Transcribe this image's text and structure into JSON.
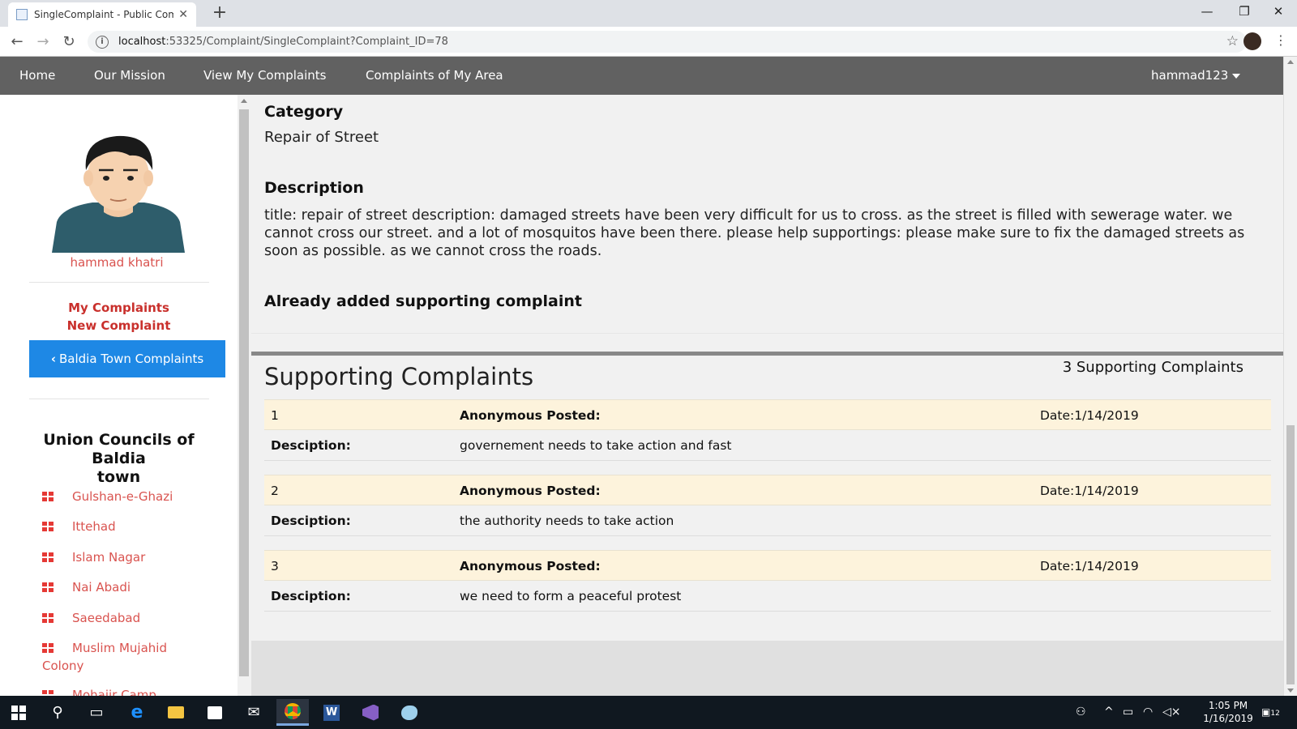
{
  "browser": {
    "tab_title": "SingleComplaint - Public Compla",
    "url_host": "localhost",
    "url_rest": ":53325/Complaint/SingleComplaint?Complaint_ID=78"
  },
  "nav": {
    "items": [
      "Home",
      "Our Mission",
      "View My Complaints",
      "Complaints of My Area"
    ],
    "user": "hammad123"
  },
  "sidebar": {
    "user_name": "hammad khatri",
    "my_complaints": "My Complaints",
    "new_complaint": "New Complaint",
    "area_button": "Baldia Town Complaints",
    "uc_heading_line1": "Union Councils of Baldia",
    "uc_heading_line2": "town",
    "councils": [
      "Gulshan-e-Ghazi",
      "Ittehad",
      "Islam Nagar",
      "Nai Abadi",
      "Saeedabad",
      "Muslim Mujahid Colony"
    ],
    "partial_item": "Mohajir Camp"
  },
  "complaint": {
    "category_label": "Category",
    "category_value": "Repair of Street",
    "description_label": "Description",
    "description_text": "title: repair of street description: damaged streets have been very difficult for us to cross. as the street is filled with sewerage water. we cannot cross our street. and a lot of mosquitos have been there. please help supportings: please make sure to fix the damaged streets as soon as possible. as we cannot cross the roads.",
    "status_text": "Already added supporting complaint"
  },
  "supporting": {
    "title": "Supporting Complaints",
    "count_text": "3 Supporting Complaints",
    "posted_label": "Anonymous Posted:",
    "desc_label": "Desciption:",
    "rows": [
      {
        "num": "1",
        "date": "Date:1/14/2019",
        "desc": "governement needs to take action and fast"
      },
      {
        "num": "2",
        "date": "Date:1/14/2019",
        "desc": "the authority needs to take action"
      },
      {
        "num": "3",
        "date": "Date:1/14/2019",
        "desc": "we need to form a peaceful protest"
      }
    ]
  },
  "taskbar": {
    "time": "1:05 PM",
    "date": "1/16/2019",
    "notifications": "12"
  },
  "colors": {
    "navbar": "#616161",
    "accent_red": "#d9534f",
    "button_blue": "#1e88e5",
    "row_highlight": "#fdf3dc"
  }
}
